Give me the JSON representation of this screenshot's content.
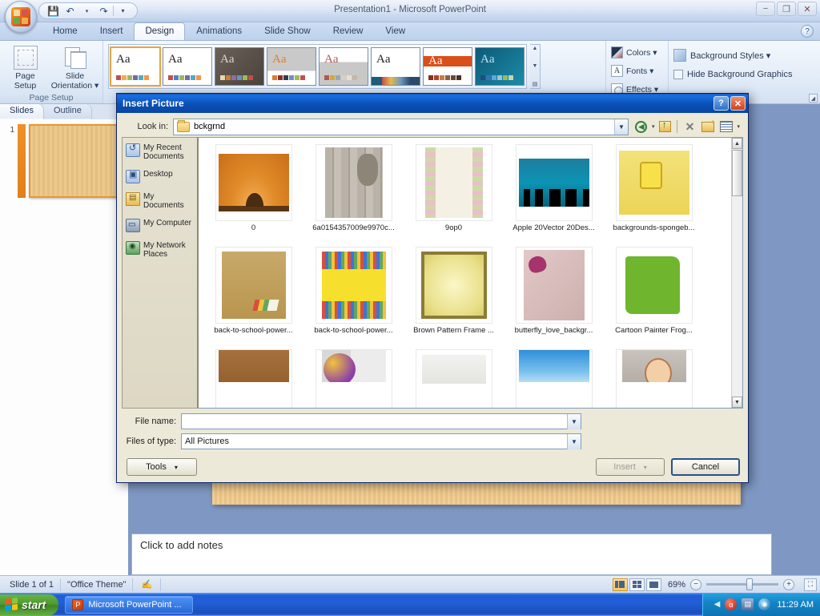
{
  "app": {
    "title": "Presentation1 - Microsoft PowerPoint",
    "quick_access": {
      "save_icon": "save-icon",
      "undo_icon": "undo-icon",
      "redo_icon": "redo-icon",
      "customize_icon": "chevron-down-icon"
    },
    "window_controls": {
      "minimize": "−",
      "restore": "❐",
      "close": "✕"
    },
    "help_label": "?"
  },
  "ribbon": {
    "tabs": [
      {
        "label": "Home",
        "active": false
      },
      {
        "label": "Insert",
        "active": false
      },
      {
        "label": "Design",
        "active": true
      },
      {
        "label": "Animations",
        "active": false
      },
      {
        "label": "Slide Show",
        "active": false
      },
      {
        "label": "Review",
        "active": false
      },
      {
        "label": "View",
        "active": false
      }
    ],
    "page_setup_group": {
      "group_label": "Page Setup",
      "page_setup_label": "Page\nSetup",
      "page_setup_line1": "Page",
      "page_setup_line2": "Setup",
      "slide_orientation_line1": "Slide",
      "slide_orientation_line2": "Orientation ▾"
    },
    "themes_group": {
      "aa_label": "Aa",
      "thumbs": [
        {
          "name": "office-theme",
          "selected": true
        },
        {
          "name": "theme-2",
          "selected": false
        },
        {
          "name": "theme-3",
          "selected": false
        },
        {
          "name": "theme-4",
          "selected": false
        },
        {
          "name": "theme-5",
          "selected": false
        },
        {
          "name": "theme-6",
          "selected": false
        },
        {
          "name": "theme-7",
          "selected": false
        },
        {
          "name": "theme-8",
          "selected": false
        }
      ]
    },
    "colors_group": {
      "colors_label": "Colors ▾",
      "fonts_label": "Fonts ▾",
      "fonts_glyph": "A",
      "effects_label": "Effects ▾"
    },
    "background_group": {
      "background_styles_label": "Background Styles ▾",
      "hide_background_graphics_label": "Hide Background Graphics"
    }
  },
  "left_pane": {
    "tabs": [
      {
        "label": "Slides",
        "active": true
      },
      {
        "label": "Outline",
        "active": false
      }
    ],
    "slide_number": "1"
  },
  "notes": {
    "placeholder": "Click to add notes"
  },
  "status_bar": {
    "slide_count": "Slide 1 of 1",
    "theme_name": "\"Office Theme\"",
    "spellcheck_icon": "spellcheck-icon",
    "view_normal": "normal-view-icon",
    "view_sorter": "slide-sorter-icon",
    "view_show": "slide-show-icon",
    "zoom_level": "69%",
    "zoom_out": "−",
    "zoom_in": "+",
    "fit_to_window": "fit-to-window-icon"
  },
  "dialog": {
    "title": "Insert Picture",
    "help_label": "?",
    "close_label": "✕",
    "look_in_label": "Look in:",
    "look_in_value": "bckgrnd",
    "toolbar": [
      {
        "name": "back-button",
        "glyph": "←",
        "has_caret": true
      },
      {
        "name": "up-one-level-button",
        "glyph": "↑",
        "has_caret": false
      },
      {
        "name": "delete-button",
        "glyph": "✕",
        "has_caret": false
      },
      {
        "name": "create-new-folder-button",
        "glyph": "✦",
        "has_caret": false
      },
      {
        "name": "views-button",
        "glyph": "▤",
        "has_caret": true
      }
    ],
    "places": [
      {
        "name": "my-recent-documents",
        "label": "My Recent Documents"
      },
      {
        "name": "desktop",
        "label": "Desktop"
      },
      {
        "name": "my-documents",
        "label": "My Documents"
      },
      {
        "name": "my-computer",
        "label": "My Computer"
      },
      {
        "name": "my-network-places",
        "label": "My Network Places"
      }
    ],
    "files": [
      {
        "label": "0",
        "art": "art-sunset"
      },
      {
        "label": "6a0154357009e9970c...",
        "art": "art-wood"
      },
      {
        "label": "9op0",
        "art": "art-floral"
      },
      {
        "label": "Apple 20Vector 20Des...",
        "art": "art-city"
      },
      {
        "label": "backgrounds-spongeb...",
        "art": "art-sponge"
      },
      {
        "label": "back-to-school-power...",
        "art": "art-books"
      },
      {
        "label": "back-to-school-power...",
        "art": "art-pencils"
      },
      {
        "label": "Brown Pattern Frame ...",
        "art": "art-brownframe"
      },
      {
        "label": "butterfly_love_backgr...",
        "art": "art-butterfly"
      },
      {
        "label": "Cartoon Painter Frog...",
        "art": "art-frog"
      },
      {
        "label": "",
        "art": "art-brown"
      },
      {
        "label": "",
        "art": "art-umbrella"
      },
      {
        "label": "",
        "art": "art-pale"
      },
      {
        "label": "",
        "art": "art-sky"
      },
      {
        "label": "",
        "art": "art-face"
      }
    ],
    "file_name_label": "File name:",
    "file_name_value": "",
    "files_of_type_label": "Files of type:",
    "files_of_type_value": "All Pictures",
    "tools_button": "Tools",
    "insert_button": "Insert",
    "cancel_button": "Cancel",
    "caret": "▾"
  },
  "taskbar": {
    "start_label": "start",
    "items": [
      {
        "label": "Microsoft PowerPoint ...",
        "icon": "powerpoint-icon"
      }
    ],
    "tray": {
      "show_hidden_icon": "chevron-left-icon",
      "icons": [
        "antivirus-icon",
        "network-icon",
        "security-center-icon"
      ],
      "time": "11:29 AM"
    }
  }
}
